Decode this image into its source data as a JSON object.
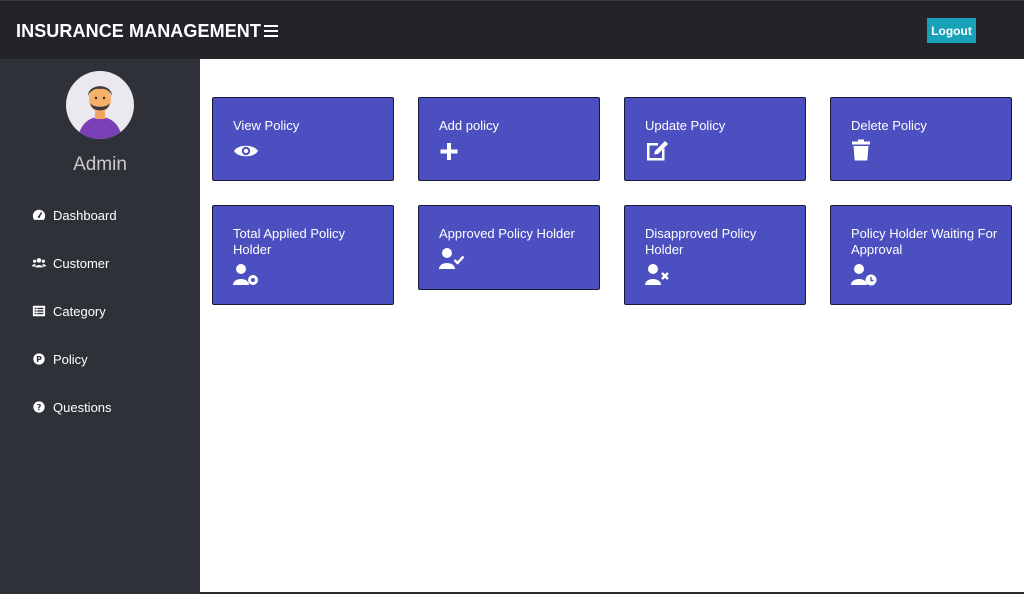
{
  "header": {
    "brand": "INSURANCE MANAGEMENT",
    "logout_label": "Logout",
    "colors": {
      "bar": "#23242a",
      "logout": "#17a2b8"
    }
  },
  "sidebar": {
    "admin_name": "Admin",
    "items": [
      {
        "label": "Dashboard",
        "icon": "tachometer-icon"
      },
      {
        "label": "Customer",
        "icon": "users-icon"
      },
      {
        "label": "Category",
        "icon": "list-icon"
      },
      {
        "label": "Policy",
        "icon": "policy-p-icon"
      },
      {
        "label": "Questions",
        "icon": "question-circle-icon"
      }
    ]
  },
  "cards": [
    {
      "title": "View Policy",
      "icon": "eye-icon"
    },
    {
      "title": "Add policy",
      "icon": "plus-icon"
    },
    {
      "title": "Update Policy",
      "icon": "edit-icon"
    },
    {
      "title": "Delete Policy",
      "icon": "trash-icon"
    },
    {
      "title": "Total Applied Policy Holder",
      "icon": "user-cog-icon"
    },
    {
      "title": "Approved Policy Holder",
      "icon": "user-check-icon"
    },
    {
      "title": "Disapproved Policy Holder",
      "icon": "user-times-icon"
    },
    {
      "title": "Policy Holder Waiting For Approval",
      "icon": "user-clock-icon"
    }
  ],
  "card_color": "#4b4fbf"
}
